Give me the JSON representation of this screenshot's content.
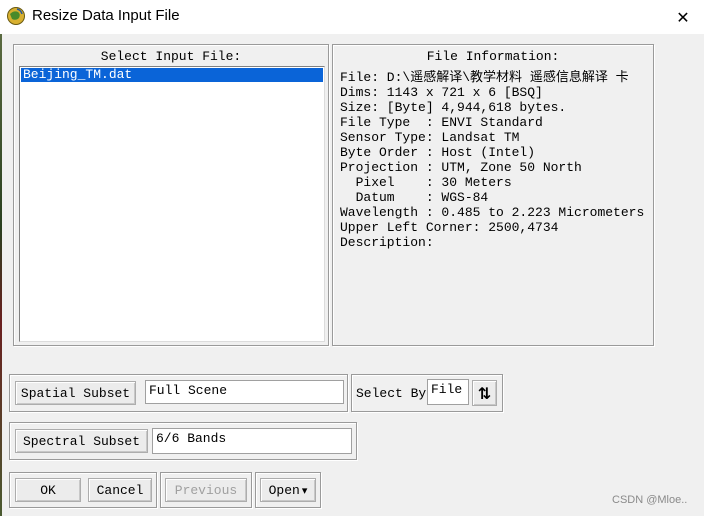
{
  "window": {
    "title": "Resize Data Input File",
    "close_glyph": "✕"
  },
  "input_panel": {
    "label": "Select Input File:",
    "files": [
      "Beijing_TM.dat"
    ],
    "selected_index": 0
  },
  "info_panel": {
    "label": "File Information:",
    "lines": [
      "File: D:\\遥感解译\\教学材料 遥感信息解译 卡",
      "Dims: 1143 x 721 x 6 [BSQ]",
      "Size: [Byte] 4,944,618 bytes.",
      "File Type  : ENVI Standard",
      "Sensor Type: Landsat TM",
      "Byte Order : Host (Intel)",
      "Projection : UTM, Zone 50 North",
      "  Pixel    : 30 Meters",
      "  Datum    : WGS-84",
      "Wavelength : 0.485 to 2.223 Micrometers",
      "Upper Left Corner: 2500,4734",
      "Description:"
    ]
  },
  "spatial": {
    "button_label": "Spatial Subset",
    "value": "Full Scene"
  },
  "select_by": {
    "label": "Select By",
    "value": "File",
    "sort_glyph": "⇅"
  },
  "spectral": {
    "button_label": "Spectral Subset",
    "value": "6/6 Bands"
  },
  "actions": {
    "ok": "OK",
    "cancel": "Cancel",
    "previous": "Previous",
    "open": "Open",
    "open_arrow": "▾"
  },
  "watermark": "CSDN @Mloe..",
  "colors": {
    "selection": "#0a64d8",
    "background": "#f0f0f0"
  }
}
